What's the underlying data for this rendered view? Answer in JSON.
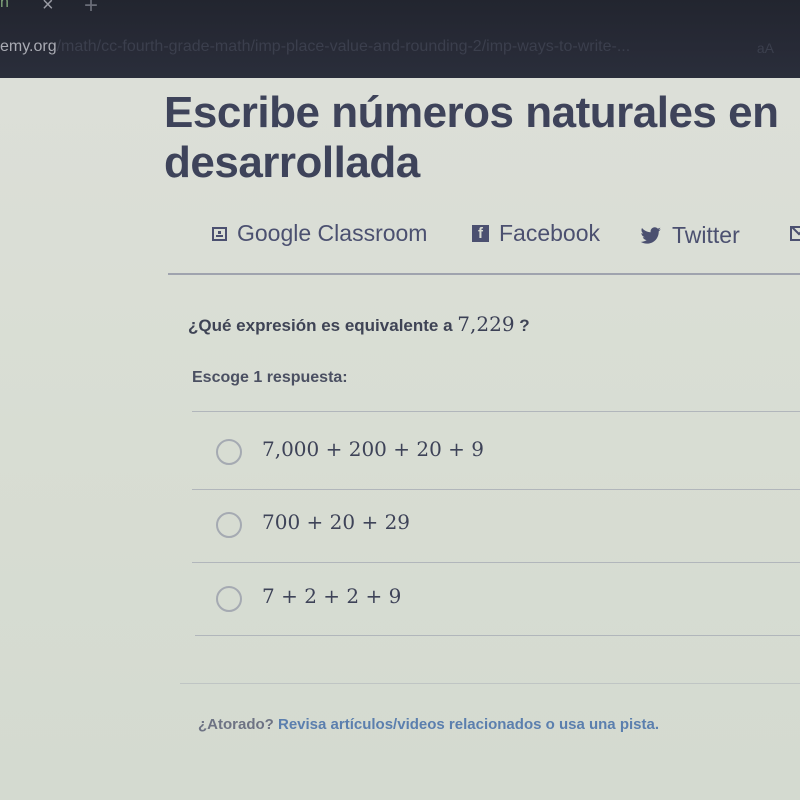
{
  "browser": {
    "tab_fragment": "n",
    "tab_close_icon": "×",
    "new_tab_icon": "+",
    "url_domain": "emy.org",
    "url_path": "/math/cc-fourth-grade-math/imp-place-value-and-rounding-2/imp-ways-to-write-...",
    "reader_icon": "aA"
  },
  "page": {
    "title": "Escribe números naturales en desarrollada",
    "share": {
      "google_classroom": "Google Classroom",
      "facebook": "Facebook",
      "facebook_glyph": "f",
      "twitter": "Twitter",
      "twitter_glyph": "🐦"
    },
    "question": {
      "prefix": "¿Qué expresión es equivalente a",
      "number": "7,229",
      "suffix": "?"
    },
    "prompt": "Escoge 1 respuesta:",
    "choices": [
      {
        "label": "7,000 + 200 + 20 + 9",
        "selected": false
      },
      {
        "label": "700 + 20 + 29",
        "selected": false
      },
      {
        "label": "7 + 2 + 2 + 9",
        "selected": false
      }
    ],
    "hint": {
      "prefix": "¿Atorado?",
      "link_text": "Revisa artículos/videos relacionados",
      "connector": "o",
      "pista_text": "usa una pista."
    }
  },
  "colors": {
    "title": "#3e435a",
    "link": "#5b7fae",
    "background": "#dcdfd8",
    "chrome": "#262935"
  }
}
